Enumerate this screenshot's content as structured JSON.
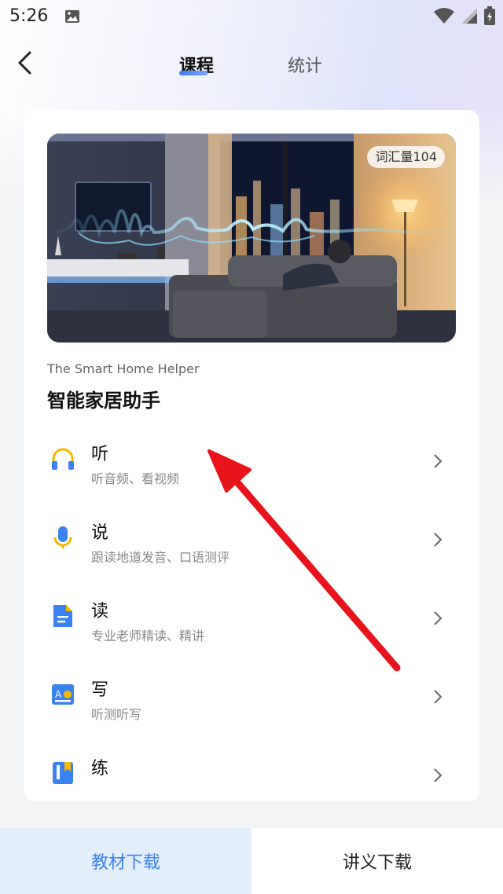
{
  "status_bar": {
    "time": "5:26"
  },
  "header": {
    "tabs": [
      {
        "label": "课程",
        "active": true
      },
      {
        "label": "统计",
        "active": false
      }
    ]
  },
  "course": {
    "vocab_badge": "词汇量104",
    "subtitle_en": "The Smart Home Helper",
    "title_cn": "智能家居助手"
  },
  "menu": [
    {
      "label": "听",
      "desc": "听音频、看视频",
      "icon": "headphones-icon"
    },
    {
      "label": "说",
      "desc": "跟读地道发音、口语测评",
      "icon": "microphone-icon"
    },
    {
      "label": "读",
      "desc": "专业老师精读、精讲",
      "icon": "document-icon"
    },
    {
      "label": "写",
      "desc": "听测听写",
      "icon": "writing-icon"
    },
    {
      "label": "练",
      "desc": "",
      "icon": "notebook-icon"
    }
  ],
  "bottom": {
    "textbook_label": "教材下载",
    "notes_label": "讲义下载"
  },
  "colors": {
    "accent": "#3a82f0",
    "annotation": "#e8141b"
  }
}
